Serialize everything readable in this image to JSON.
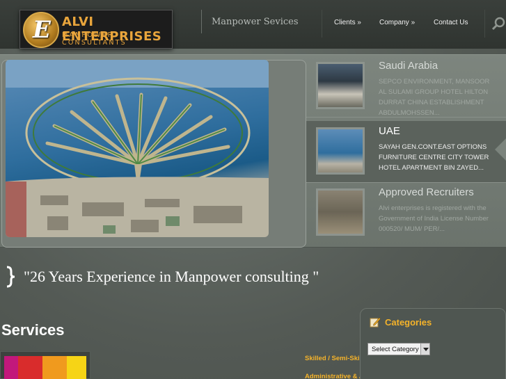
{
  "header": {
    "logo_title": "ALVI ENTERPRISES",
    "logo_subtitle": "MANPOWER CONSULTANTS",
    "tagline": "Manpower Sevices",
    "nav": [
      {
        "label": "Clients »"
      },
      {
        "label": "Company »"
      },
      {
        "label": "Contact Us"
      }
    ]
  },
  "slider": {
    "items": [
      {
        "title": "Saudi Arabia",
        "desc": "SEPCO ENVIRONMENT, MANSOOR AL SULAMI GROUP HOTEL HILTON DURRAT CHINA ESTABLISHMENT ABDULMOHSSEN...",
        "active": false
      },
      {
        "title": "UAE",
        "desc": "SAYAH GEN.CONT.EAST OPTIONS FURNITURE CENTRE CITY TOWER HOTEL APARTMENT BIN ZAYED...",
        "active": true
      },
      {
        "title": "Approved Recruiters",
        "desc": "Alvi enterprises is registered with the Government of India License Number 000520/ MUM/ PER/...",
        "active": false
      }
    ]
  },
  "quote": "\"26 Years Experience in Manpower consulting \"",
  "services": {
    "title": "Services",
    "swatches": [
      "#c2187b",
      "#d92c2c",
      "#f09a1e",
      "#f6d416"
    ],
    "links": [
      "Skilled / Semi-Skill",
      "Administrative & Accounts"
    ]
  },
  "categories": {
    "title": "Categories",
    "select_value": "Select Category"
  },
  "colors": {
    "accent": "#f5b32a",
    "logo_gold": "#e9a53c"
  }
}
